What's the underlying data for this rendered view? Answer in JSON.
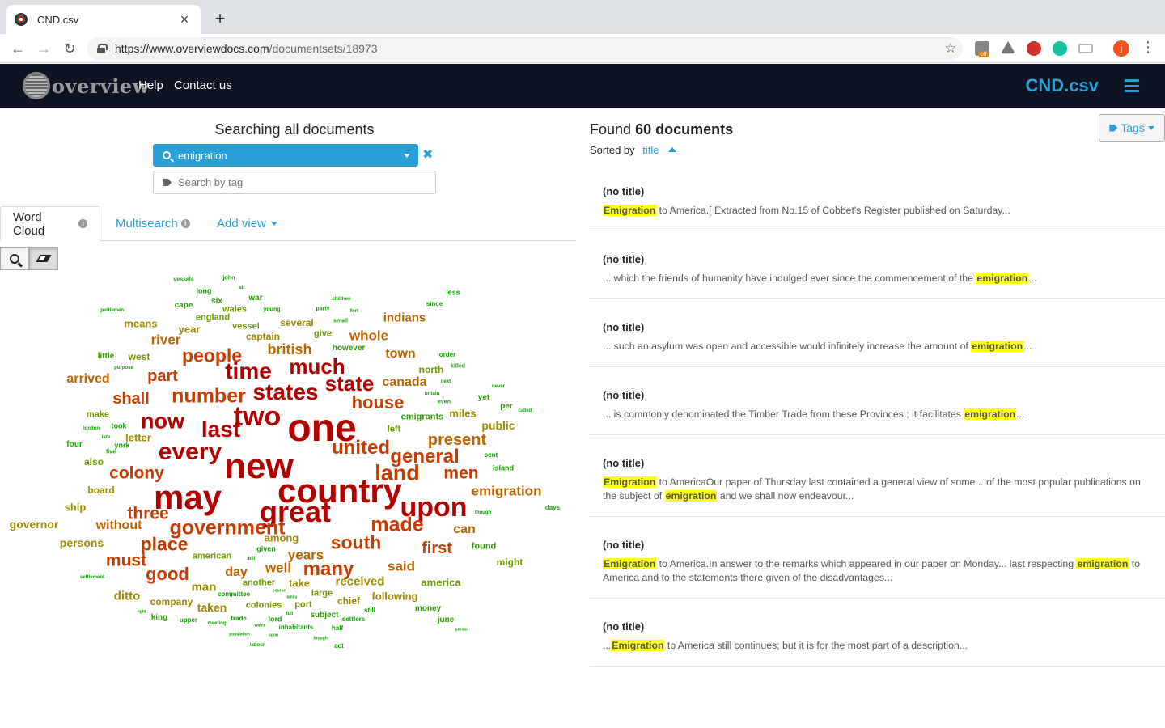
{
  "browser": {
    "tab_title": "CND.csv",
    "tab_close": "×",
    "new_tab": "+",
    "url_host": "https://www.overviewdocs.com",
    "url_path": "/documentsets/18973",
    "ext_badge": "off",
    "profile_initial": "j"
  },
  "app": {
    "logo_text": "overview",
    "nav_help": "Help",
    "nav_contact": "Contact us",
    "document_set": "CND.csv"
  },
  "search": {
    "heading": "Searching all documents",
    "query": "emigration",
    "tag_placeholder": "Search by tag"
  },
  "views": {
    "word_cloud": "Word Cloud",
    "multisearch": "Multisearch",
    "add_view": "Add view"
  },
  "results": {
    "found_prefix": "Found",
    "found_count": "60 documents",
    "sorted_by": "Sorted by",
    "sort_field": "title",
    "tags_button": "Tags",
    "documents": [
      {
        "title": "(no title)",
        "parts": [
          {
            "hl": true,
            "t": "Emigration"
          },
          {
            "hl": false,
            "t": " to America.[ Extracted from No.15 of Cobbet's Register published on Saturday..."
          }
        ]
      },
      {
        "title": "(no title)",
        "parts": [
          {
            "hl": false,
            "t": "... which the friends of humanity have indulged ever since the commencement of the "
          },
          {
            "hl": true,
            "t": "emigration"
          },
          {
            "hl": false,
            "t": "..."
          }
        ]
      },
      {
        "title": "(no title)",
        "parts": [
          {
            "hl": false,
            "t": "... such an asylum was open and accessible would infinitely increase the amount of "
          },
          {
            "hl": true,
            "t": "emigration"
          },
          {
            "hl": false,
            "t": "..."
          }
        ]
      },
      {
        "title": "(no title)",
        "parts": [
          {
            "hl": false,
            "t": "... is commonly denominated the Timber Trade from these Provinces ; it facilitates "
          },
          {
            "hl": true,
            "t": "emigration"
          },
          {
            "hl": false,
            "t": "..."
          }
        ]
      },
      {
        "title": "(no title)",
        "parts": [
          {
            "hl": true,
            "t": "Emigration"
          },
          {
            "hl": false,
            "t": " to AmericaOur paper of Thursday last contained a general view of some ...of the most popular publications on the subject of "
          },
          {
            "hl": true,
            "t": "emigration"
          },
          {
            "hl": false,
            "t": " and we shall now endeavour..."
          }
        ]
      },
      {
        "title": "(no title)",
        "parts": [
          {
            "hl": true,
            "t": "Emigration"
          },
          {
            "hl": false,
            "t": " to America.In answer to the remarks which appeared in our paper on Monday... last respecting "
          },
          {
            "hl": true,
            "t": "emigration"
          },
          {
            "hl": false,
            "t": " to America and to the statements there given of the disadvantages..."
          }
        ]
      },
      {
        "title": "(no title)",
        "parts": [
          {
            "hl": false,
            "t": "..."
          },
          {
            "hl": true,
            "t": "Emigration"
          },
          {
            "hl": false,
            "t": " to America still continues; but it is for the most part of a description..."
          }
        ]
      }
    ]
  },
  "colors": {
    "header_bg": "#0e1424",
    "accent": "#2a9fd8",
    "highlight": "#ffff1a",
    "cloud_levels": [
      "#b00000",
      "#c43c00",
      "#b86400",
      "#9e8a00",
      "#6e9a00",
      "#2e9900",
      "#10a000"
    ]
  },
  "word_cloud": [
    {
      "w": "one",
      "lvl": 0,
      "s": 48
    },
    {
      "w": "new",
      "lvl": 0,
      "s": 44
    },
    {
      "w": "country",
      "lvl": 0,
      "s": 42
    },
    {
      "w": "may",
      "lvl": 0,
      "s": 42
    },
    {
      "w": "great",
      "lvl": 0,
      "s": 36
    },
    {
      "w": "two",
      "lvl": 0,
      "s": 34
    },
    {
      "w": "upon",
      "lvl": 0,
      "s": 34
    },
    {
      "w": "every",
      "lvl": 0,
      "s": 30
    },
    {
      "w": "states",
      "lvl": 0,
      "s": 28
    },
    {
      "w": "time",
      "lvl": 0,
      "s": 28
    },
    {
      "w": "last",
      "lvl": 0,
      "s": 28
    },
    {
      "w": "now",
      "lvl": 0,
      "s": 27
    },
    {
      "w": "much",
      "lvl": 0,
      "s": 26
    },
    {
      "w": "state",
      "lvl": 0,
      "s": 26
    },
    {
      "w": "number",
      "lvl": 1,
      "s": 25
    },
    {
      "w": "government",
      "lvl": 1,
      "s": 25
    },
    {
      "w": "made",
      "lvl": 1,
      "s": 25
    },
    {
      "w": "land",
      "lvl": 1,
      "s": 27
    },
    {
      "w": "general",
      "lvl": 1,
      "s": 24
    },
    {
      "w": "united",
      "lvl": 1,
      "s": 24
    },
    {
      "w": "many",
      "lvl": 1,
      "s": 24
    },
    {
      "w": "people",
      "lvl": 1,
      "s": 23
    },
    {
      "w": "place",
      "lvl": 1,
      "s": 23
    },
    {
      "w": "south",
      "lvl": 1,
      "s": 23
    },
    {
      "w": "good",
      "lvl": 1,
      "s": 22
    },
    {
      "w": "house",
      "lvl": 1,
      "s": 22
    },
    {
      "w": "men",
      "lvl": 1,
      "s": 21
    },
    {
      "w": "colony",
      "lvl": 1,
      "s": 21
    },
    {
      "w": "three",
      "lvl": 1,
      "s": 21
    },
    {
      "w": "must",
      "lvl": 1,
      "s": 21
    },
    {
      "w": "part",
      "lvl": 1,
      "s": 20
    },
    {
      "w": "shall",
      "lvl": 1,
      "s": 20
    },
    {
      "w": "first",
      "lvl": 1,
      "s": 20
    },
    {
      "w": "present",
      "lvl": 2,
      "s": 20
    },
    {
      "w": "british",
      "lvl": 2,
      "s": 18
    },
    {
      "w": "years",
      "lvl": 2,
      "s": 17
    },
    {
      "w": "well",
      "lvl": 2,
      "s": 17
    },
    {
      "w": "river",
      "lvl": 2,
      "s": 17
    },
    {
      "w": "said",
      "lvl": 2,
      "s": 17
    },
    {
      "w": "whole",
      "lvl": 2,
      "s": 17
    },
    {
      "w": "emigration",
      "lvl": 2,
      "s": 17
    },
    {
      "w": "canada",
      "lvl": 2,
      "s": 16
    },
    {
      "w": "town",
      "lvl": 2,
      "s": 16
    },
    {
      "w": "day",
      "lvl": 2,
      "s": 16
    },
    {
      "w": "arrived",
      "lvl": 2,
      "s": 16
    },
    {
      "w": "without",
      "lvl": 2,
      "s": 16
    },
    {
      "w": "can",
      "lvl": 2,
      "s": 16
    },
    {
      "w": "indians",
      "lvl": 2,
      "s": 15
    },
    {
      "w": "received",
      "lvl": 3,
      "s": 15
    },
    {
      "w": "ditto",
      "lvl": 3,
      "s": 15
    },
    {
      "w": "man",
      "lvl": 3,
      "s": 15
    },
    {
      "w": "public",
      "lvl": 3,
      "s": 14
    },
    {
      "w": "governor",
      "lvl": 3,
      "s": 14
    },
    {
      "w": "persons",
      "lvl": 3,
      "s": 14
    },
    {
      "w": "taken",
      "lvl": 3,
      "s": 14
    },
    {
      "w": "miles",
      "lvl": 3,
      "s": 13
    },
    {
      "w": "among",
      "lvl": 3,
      "s": 13
    },
    {
      "w": "letter",
      "lvl": 3,
      "s": 13
    },
    {
      "w": "following",
      "lvl": 3,
      "s": 13
    },
    {
      "w": "ship",
      "lvl": 3,
      "s": 13
    },
    {
      "w": "year",
      "lvl": 3,
      "s": 13
    },
    {
      "w": "means",
      "lvl": 3,
      "s": 13
    },
    {
      "w": "america",
      "lvl": 4,
      "s": 13
    },
    {
      "w": "take",
      "lvl": 3,
      "s": 13
    },
    {
      "w": "board",
      "lvl": 3,
      "s": 12
    },
    {
      "w": "several",
      "lvl": 3,
      "s": 12
    },
    {
      "w": "captain",
      "lvl": 3,
      "s": 12
    },
    {
      "w": "company",
      "lvl": 3,
      "s": 12
    },
    {
      "w": "chief",
      "lvl": 3,
      "s": 12
    },
    {
      "w": "might",
      "lvl": 4,
      "s": 12
    },
    {
      "w": "north",
      "lvl": 4,
      "s": 12
    },
    {
      "w": "make",
      "lvl": 4,
      "s": 11
    },
    {
      "w": "west",
      "lvl": 4,
      "s": 12
    },
    {
      "w": "give",
      "lvl": 4,
      "s": 11
    },
    {
      "w": "vessel",
      "lvl": 4,
      "s": 11
    },
    {
      "w": "england",
      "lvl": 4,
      "s": 11
    },
    {
      "w": "wales",
      "lvl": 4,
      "s": 11
    },
    {
      "w": "emigrants",
      "lvl": 5,
      "s": 11
    },
    {
      "w": "port",
      "lvl": 4,
      "s": 11
    },
    {
      "w": "colonies",
      "lvl": 4,
      "s": 11
    },
    {
      "w": "another",
      "lvl": 4,
      "s": 11
    },
    {
      "w": "american",
      "lvl": 4,
      "s": 11
    },
    {
      "w": "also",
      "lvl": 4,
      "s": 12
    },
    {
      "w": "large",
      "lvl": 4,
      "s": 11
    },
    {
      "w": "found",
      "lvl": 5,
      "s": 11
    },
    {
      "w": "left",
      "lvl": 4,
      "s": 11
    },
    {
      "w": "yet",
      "lvl": 5,
      "s": 10
    },
    {
      "w": "however",
      "lvl": 5,
      "s": 10
    },
    {
      "w": "little",
      "lvl": 5,
      "s": 10
    },
    {
      "w": "money",
      "lvl": 5,
      "s": 10
    },
    {
      "w": "june",
      "lvl": 5,
      "s": 10
    },
    {
      "w": "subject",
      "lvl": 5,
      "s": 10
    },
    {
      "w": "king",
      "lvl": 5,
      "s": 10
    },
    {
      "w": "cape",
      "lvl": 5,
      "s": 10
    },
    {
      "w": "six",
      "lvl": 5,
      "s": 10
    },
    {
      "w": "war",
      "lvl": 5,
      "s": 10
    },
    {
      "w": "per",
      "lvl": 5,
      "s": 10
    },
    {
      "w": "took",
      "lvl": 6,
      "s": 9
    },
    {
      "w": "four",
      "lvl": 6,
      "s": 10
    },
    {
      "w": "york",
      "lvl": 6,
      "s": 9
    },
    {
      "w": "given",
      "lvl": 6,
      "s": 9
    },
    {
      "w": "lord",
      "lvl": 6,
      "s": 9
    },
    {
      "w": "island",
      "lvl": 6,
      "s": 9
    },
    {
      "w": "committee",
      "lvl": 6,
      "s": 8
    },
    {
      "w": "inhabitants",
      "lvl": 6,
      "s": 8
    },
    {
      "w": "trade",
      "lvl": 6,
      "s": 8
    },
    {
      "w": "upper",
      "lvl": 6,
      "s": 8
    },
    {
      "w": "long",
      "lvl": 6,
      "s": 9
    },
    {
      "w": "less",
      "lvl": 6,
      "s": 9
    },
    {
      "w": "since",
      "lvl": 6,
      "s": 8
    },
    {
      "w": "sent",
      "lvl": 6,
      "s": 8
    },
    {
      "w": "order",
      "lvl": 6,
      "s": 8
    },
    {
      "w": "killed",
      "lvl": 6,
      "s": 7
    },
    {
      "w": "settlers",
      "lvl": 6,
      "s": 8
    },
    {
      "w": "still",
      "lvl": 6,
      "s": 8
    },
    {
      "w": "half",
      "lvl": 6,
      "s": 8
    },
    {
      "w": "act",
      "lvl": 6,
      "s": 8
    },
    {
      "w": "days",
      "lvl": 6,
      "s": 8
    },
    {
      "w": "john",
      "lvl": 6,
      "s": 7
    },
    {
      "w": "vessels",
      "lvl": 6,
      "s": 7
    },
    {
      "w": "sir",
      "lvl": 6,
      "s": 6
    },
    {
      "w": "young",
      "lvl": 6,
      "s": 7
    },
    {
      "w": "party",
      "lvl": 6,
      "s": 7
    },
    {
      "w": "children",
      "lvl": 6,
      "s": 6
    },
    {
      "w": "fort",
      "lvl": 6,
      "s": 6
    },
    {
      "w": "small",
      "lvl": 6,
      "s": 7
    },
    {
      "w": "gentlemen",
      "lvl": 6,
      "s": 6
    },
    {
      "w": "purpose",
      "lvl": 6,
      "s": 6
    },
    {
      "w": "next",
      "lvl": 6,
      "s": 6
    },
    {
      "w": "never",
      "lvl": 6,
      "s": 6
    },
    {
      "w": "britain",
      "lvl": 6,
      "s": 6
    },
    {
      "w": "even",
      "lvl": 6,
      "s": 7
    },
    {
      "w": "called",
      "lvl": 6,
      "s": 6
    },
    {
      "w": "london",
      "lvl": 6,
      "s": 6
    },
    {
      "w": "late",
      "lvl": 6,
      "s": 6
    },
    {
      "w": "five",
      "lvl": 6,
      "s": 7
    },
    {
      "w": "though",
      "lvl": 6,
      "s": 6
    },
    {
      "w": "bill",
      "lvl": 6,
      "s": 6
    },
    {
      "w": "settlement",
      "lvl": 6,
      "s": 6
    },
    {
      "w": "course",
      "lvl": 6,
      "s": 5
    },
    {
      "w": "family",
      "lvl": 6,
      "s": 5
    },
    {
      "w": "full",
      "lvl": 6,
      "s": 6
    },
    {
      "w": "right",
      "lvl": 6,
      "s": 5
    },
    {
      "w": "meeting",
      "lvl": 6,
      "s": 6
    },
    {
      "w": "water",
      "lvl": 6,
      "s": 5
    },
    {
      "w": "population",
      "lvl": 6,
      "s": 5
    },
    {
      "w": "soon",
      "lvl": 6,
      "s": 5
    },
    {
      "w": "brought",
      "lvl": 6,
      "s": 5
    },
    {
      "w": "person",
      "lvl": 6,
      "s": 5
    },
    {
      "w": "labour",
      "lvl": 6,
      "s": 6
    }
  ]
}
